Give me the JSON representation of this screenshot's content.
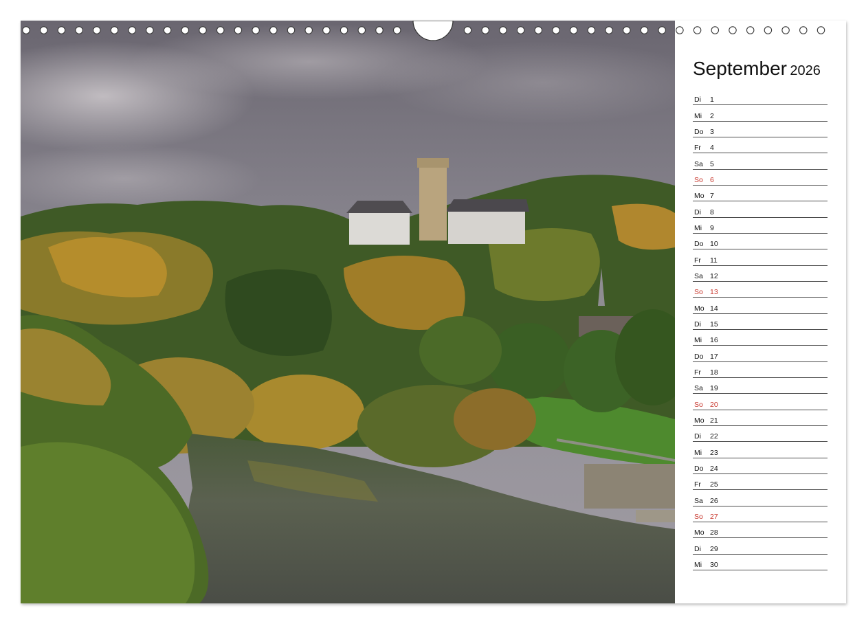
{
  "calendar": {
    "month": "September",
    "year": "2026",
    "sunday_color": "#c8372d",
    "days": [
      {
        "wd": "Di",
        "n": "1"
      },
      {
        "wd": "Mi",
        "n": "2"
      },
      {
        "wd": "Do",
        "n": "3"
      },
      {
        "wd": "Fr",
        "n": "4"
      },
      {
        "wd": "Sa",
        "n": "5"
      },
      {
        "wd": "So",
        "n": "6"
      },
      {
        "wd": "Mo",
        "n": "7"
      },
      {
        "wd": "Di",
        "n": "8"
      },
      {
        "wd": "Mi",
        "n": "9"
      },
      {
        "wd": "Do",
        "n": "10"
      },
      {
        "wd": "Fr",
        "n": "11"
      },
      {
        "wd": "Sa",
        "n": "12"
      },
      {
        "wd": "So",
        "n": "13"
      },
      {
        "wd": "Mo",
        "n": "14"
      },
      {
        "wd": "Di",
        "n": "15"
      },
      {
        "wd": "Mi",
        "n": "16"
      },
      {
        "wd": "Do",
        "n": "17"
      },
      {
        "wd": "Fr",
        "n": "18"
      },
      {
        "wd": "Sa",
        "n": "19"
      },
      {
        "wd": "So",
        "n": "20"
      },
      {
        "wd": "Mo",
        "n": "21"
      },
      {
        "wd": "Di",
        "n": "22"
      },
      {
        "wd": "Mi",
        "n": "23"
      },
      {
        "wd": "Do",
        "n": "24"
      },
      {
        "wd": "Fr",
        "n": "25"
      },
      {
        "wd": "Sa",
        "n": "26"
      },
      {
        "wd": "So",
        "n": "27"
      },
      {
        "wd": "Mo",
        "n": "28"
      },
      {
        "wd": "Di",
        "n": "29"
      },
      {
        "wd": "Mi",
        "n": "30"
      }
    ]
  }
}
